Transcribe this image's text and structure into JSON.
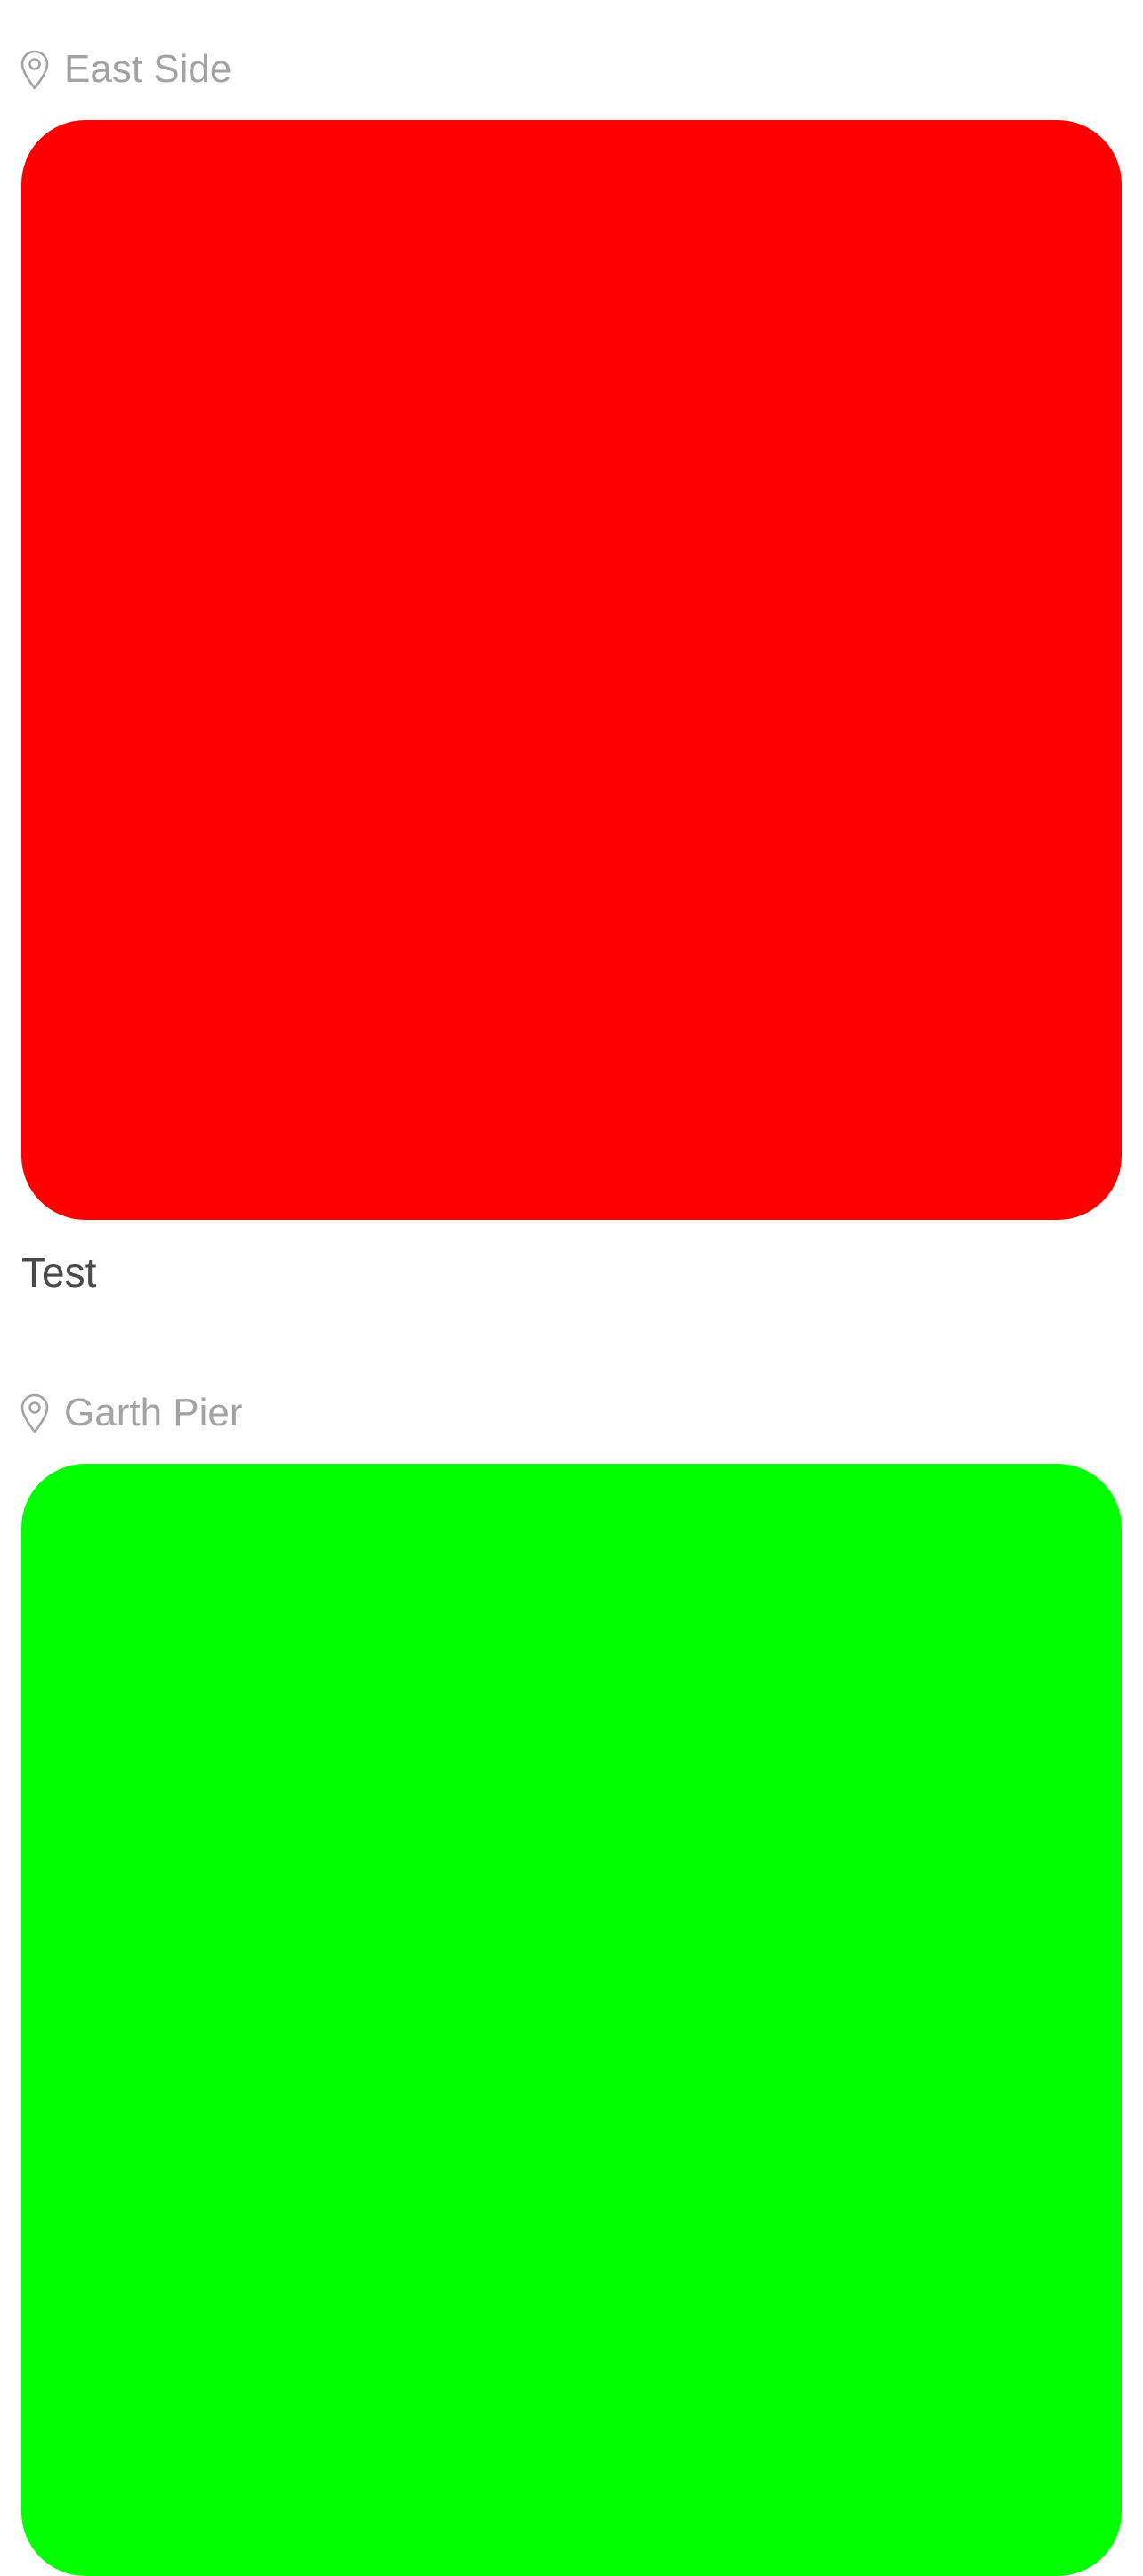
{
  "posts": [
    {
      "location": "East Side",
      "location_icon": "map-pin-icon",
      "image_color": "#ff0000",
      "caption": "Test"
    },
    {
      "location": "Garth Pier",
      "location_icon": "map-pin-icon",
      "image_color": "#00ff00",
      "caption": ""
    }
  ]
}
